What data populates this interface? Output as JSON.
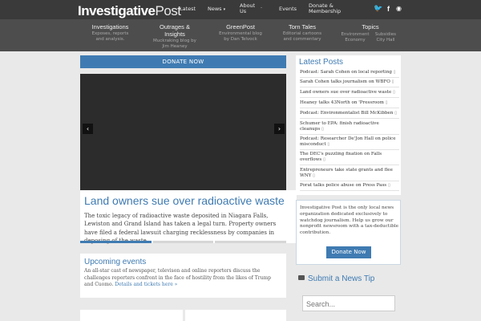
{
  "brand": {
    "logo_bold": "Investigative",
    "logo_light": "Post"
  },
  "nav": {
    "latest": "Latest",
    "news": "News",
    "about": "About Us",
    "events": "Events",
    "donate": "Donate & Membership",
    "dot": "."
  },
  "social": {
    "twitter": "🐦",
    "facebook": "f",
    "rss": "◉"
  },
  "subnav": [
    {
      "title": "Investigations",
      "desc": "Exposes, reports and analysis."
    },
    {
      "title": "Outrages & Insights",
      "desc": "Muckraking blog by Jim Heaney"
    },
    {
      "title": "GreenPost",
      "desc": "Environmental blog by Dan Telvock"
    },
    {
      "title": "Torn Tales",
      "desc": "Editorial cartoons and commentary"
    },
    {
      "title": "Topics",
      "desc_left": "Environment Economy",
      "desc_right": "Subsidies City Hall"
    }
  ],
  "donate_bar": "DONATE NOW",
  "slider": {
    "prev": "‹",
    "next": "›"
  },
  "article": {
    "headline": "Land owners sue over radioactive waste",
    "summary": "The toxic legacy of radioactive waste deposited in Niagara Falls, Lewiston and Grand Island has taken a legal turn. Property owners have filed a federal lawsuit charging recklessness by companies in deposing of the waste."
  },
  "events": {
    "title": "Upcoming events",
    "text": "An all-star cast of newspaper, televison and online reporters discuss the challenges reporters confront in the face of hostility from the likes of Trump and Cuomo. ",
    "link": "Details and tickets here »"
  },
  "latest": {
    "title": "Latest Posts",
    "posts": [
      "Podcast: Sarah Cohen on local reporting",
      "Sarah Cohen talks journalism on WBFO",
      "Land owners sue over radioactive waste",
      "Heaney talks 43North on 'Pressroom",
      "Podcast: Environmentalist Bill McKibben",
      "Schumer to EPA: finish radioactive cleanups",
      "Podcast: Researcher De'Jon Hall on police misconduct",
      "The DEC's puzzling fixation on Falls overflows",
      "Entrepreneurs take state grants and flee WNY",
      "Porat talks police abuse on Press Pass"
    ]
  },
  "about": {
    "text": "Investigative Post is the only local news organization dedicated exclusively to watchdog journalism. Help us grow our nonprofit newsroom with a tax-deductible contribution.",
    "button": "Donate Now"
  },
  "tip": "Submit a News Tip",
  "search": {
    "placeholder": "Search..."
  },
  "colors": {
    "accent": "#3f7bb2",
    "header": "#3a3a3a",
    "subnav": "#4d4d4d"
  }
}
